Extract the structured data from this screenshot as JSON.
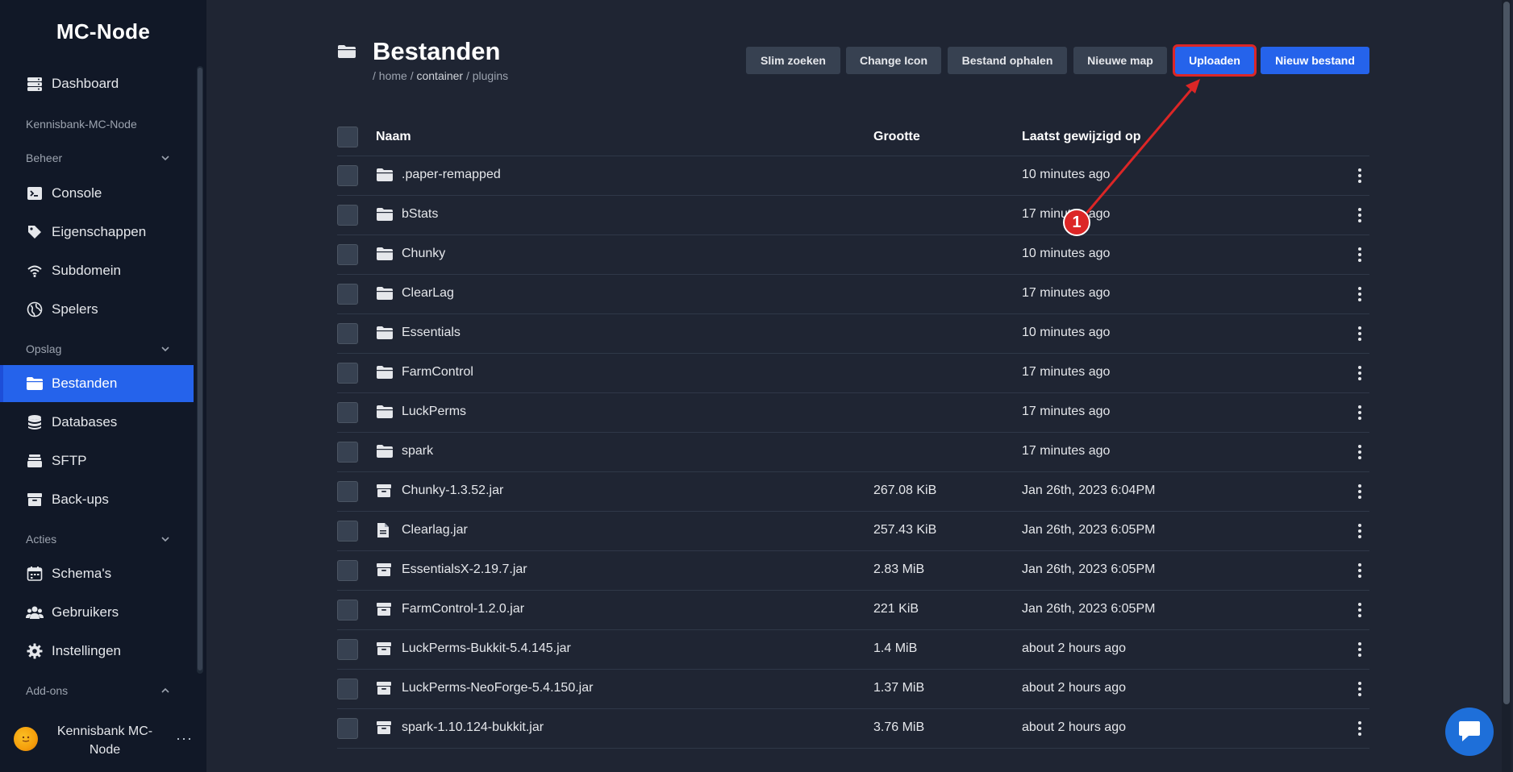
{
  "app": {
    "brand": "MC-Node"
  },
  "sidebar": {
    "top_items": [
      {
        "label": "Dashboard",
        "icon": "server-icon"
      }
    ],
    "server_name": "Kennisbank-MC-Node",
    "sections": [
      {
        "title": "Beheer",
        "icon": "chevron-down-icon",
        "items": [
          {
            "label": "Console",
            "icon": "terminal-icon"
          },
          {
            "label": "Eigenschappen",
            "icon": "tag-icon"
          },
          {
            "label": "Subdomein",
            "icon": "wifi-icon"
          },
          {
            "label": "Spelers",
            "icon": "globe-icon"
          }
        ]
      },
      {
        "title": "Opslag",
        "icon": "chevron-down-icon",
        "items": [
          {
            "label": "Bestanden",
            "icon": "folder-icon",
            "active": true
          },
          {
            "label": "Databases",
            "icon": "database-icon"
          },
          {
            "label": "SFTP",
            "icon": "layers-icon"
          },
          {
            "label": "Back-ups",
            "icon": "archive-icon"
          }
        ]
      },
      {
        "title": "Acties",
        "icon": "chevron-down-icon",
        "items": [
          {
            "label": "Schema's",
            "icon": "calendar-icon"
          },
          {
            "label": "Gebruikers",
            "icon": "users-icon"
          },
          {
            "label": "Instellingen",
            "icon": "gear-icon"
          }
        ]
      },
      {
        "title": "Add-ons",
        "icon": "chevron-up-icon",
        "items": []
      }
    ],
    "user": {
      "name": "Kennisbank MC-Node",
      "more": "···"
    }
  },
  "page": {
    "title": "Bestanden",
    "breadcrumb": {
      "sep": "/",
      "parts": [
        "home",
        "container",
        "plugins"
      ]
    }
  },
  "toolbar": {
    "buttons": [
      {
        "label": "Slim zoeken"
      },
      {
        "label": "Change Icon"
      },
      {
        "label": "Bestand ophalen"
      },
      {
        "label": "Nieuwe map"
      },
      {
        "label": "Uploaden",
        "highlighted": true
      },
      {
        "label": "Nieuw bestand"
      }
    ]
  },
  "table": {
    "headers": {
      "name": "Naam",
      "size": "Grootte",
      "modified": "Laatst gewijzigd op"
    },
    "rows": [
      {
        "type": "folder",
        "name": ".paper-remapped",
        "size": "",
        "modified": "10 minutes ago"
      },
      {
        "type": "folder",
        "name": "bStats",
        "size": "",
        "modified": "17 minutes ago"
      },
      {
        "type": "folder",
        "name": "Chunky",
        "size": "",
        "modified": "10 minutes ago"
      },
      {
        "type": "folder",
        "name": "ClearLag",
        "size": "",
        "modified": "17 minutes ago"
      },
      {
        "type": "folder",
        "name": "Essentials",
        "size": "",
        "modified": "10 minutes ago"
      },
      {
        "type": "folder",
        "name": "FarmControl",
        "size": "",
        "modified": "17 minutes ago"
      },
      {
        "type": "folder",
        "name": "LuckPerms",
        "size": "",
        "modified": "17 minutes ago"
      },
      {
        "type": "folder",
        "name": "spark",
        "size": "",
        "modified": "17 minutes ago"
      },
      {
        "type": "archive",
        "name": "Chunky-1.3.52.jar",
        "size": "267.08 KiB",
        "modified": "Jan 26th, 2023 6:04PM"
      },
      {
        "type": "file",
        "name": "Clearlag.jar",
        "size": "257.43 KiB",
        "modified": "Jan 26th, 2023 6:05PM"
      },
      {
        "type": "archive",
        "name": "EssentialsX-2.19.7.jar",
        "size": "2.83 MiB",
        "modified": "Jan 26th, 2023 6:05PM"
      },
      {
        "type": "archive",
        "name": "FarmControl-1.2.0.jar",
        "size": "221 KiB",
        "modified": "Jan 26th, 2023 6:05PM"
      },
      {
        "type": "archive",
        "name": "LuckPerms-Bukkit-5.4.145.jar",
        "size": "1.4 MiB",
        "modified": "about 2 hours ago"
      },
      {
        "type": "archive",
        "name": "LuckPerms-NeoForge-5.4.150.jar",
        "size": "1.37 MiB",
        "modified": "about 2 hours ago"
      },
      {
        "type": "archive",
        "name": "spark-1.10.124-bukkit.jar",
        "size": "3.76 MiB",
        "modified": "about 2 hours ago"
      }
    ]
  },
  "annotation": {
    "badge": "1"
  },
  "colors": {
    "accent": "#2563eb",
    "highlight": "#dc2626",
    "sidebar_bg": "#111827",
    "main_bg": "#1f2533"
  }
}
